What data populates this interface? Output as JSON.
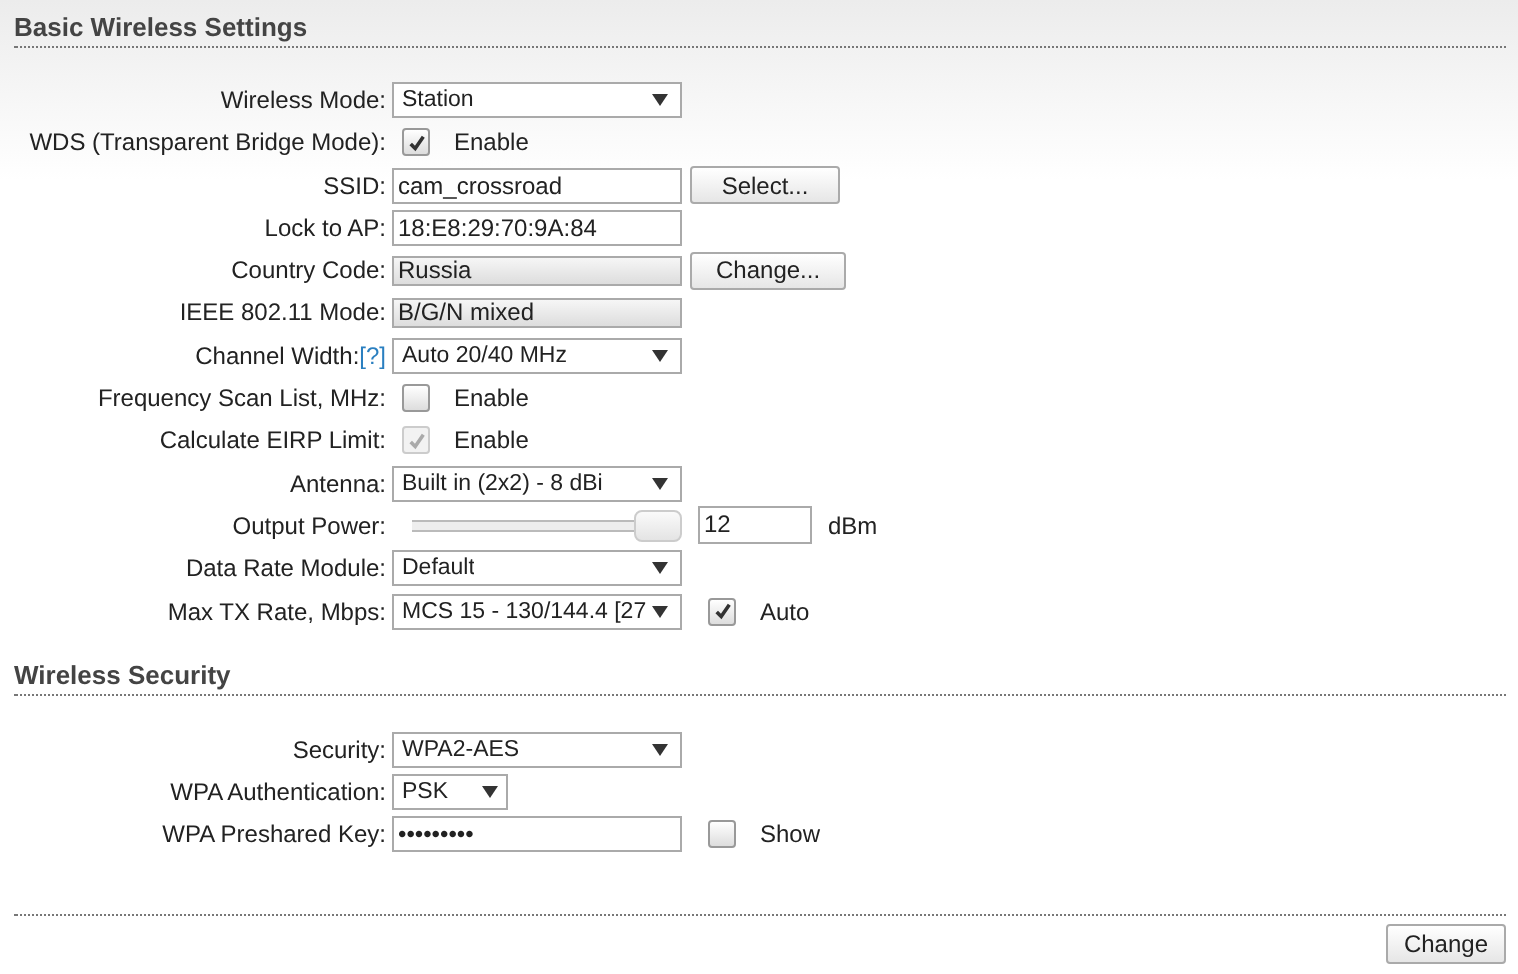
{
  "sections": [
    {
      "title": "Basic Wireless Settings",
      "rows": [
        {
          "label": "Wireless Mode:",
          "kind": "select",
          "value": "Station"
        },
        {
          "label": "WDS (Transparent Bridge Mode):",
          "kind": "checkbox",
          "checked": true,
          "disabled": false,
          "text": "Enable"
        },
        {
          "label": "SSID:",
          "kind": "input",
          "value": "cam_crossroad",
          "button": "Select..."
        },
        {
          "label": "Lock to AP:",
          "kind": "input",
          "value": "18:E8:29:70:9A:84"
        },
        {
          "label": "Country Code:",
          "kind": "readonly",
          "value": "Russia",
          "button": "Change..."
        },
        {
          "label": "IEEE 802.11 Mode:",
          "kind": "readonly",
          "value": "B/G/N mixed"
        },
        {
          "label": "Channel Width:",
          "help": "[?]",
          "kind": "select",
          "value": "Auto 20/40 MHz"
        },
        {
          "label": "Frequency Scan List, MHz:",
          "kind": "checkbox",
          "checked": false,
          "disabled": false,
          "text": "Enable"
        },
        {
          "label": "Calculate EIRP Limit:",
          "kind": "checkbox",
          "checked": true,
          "disabled": true,
          "text": "Enable"
        },
        {
          "label": "Antenna:",
          "kind": "select",
          "value": "Built in (2x2) - 8 dBi"
        },
        {
          "label": "Output Power:",
          "kind": "slider",
          "level": 1,
          "value": "12",
          "unit": "dBm"
        },
        {
          "label": "Data Rate Module:",
          "kind": "select",
          "value": "Default"
        },
        {
          "label": "Max TX Rate, Mbps:",
          "kind": "select",
          "value": "MCS 15 - 130/144.4 [27",
          "extra": {
            "text": "Auto",
            "checked": true
          }
        }
      ]
    },
    {
      "title": "Wireless Security",
      "rows": [
        {
          "label": "Security:",
          "kind": "select",
          "value": "WPA2-AES"
        },
        {
          "label": "WPA Authentication:",
          "kind": "small_select",
          "value": "PSK"
        },
        {
          "label": "WPA Preshared Key:",
          "kind": "password",
          "value": "•••••••••",
          "extra": {
            "text": "Show",
            "checked": false
          }
        }
      ]
    }
  ],
  "submit": "Change"
}
